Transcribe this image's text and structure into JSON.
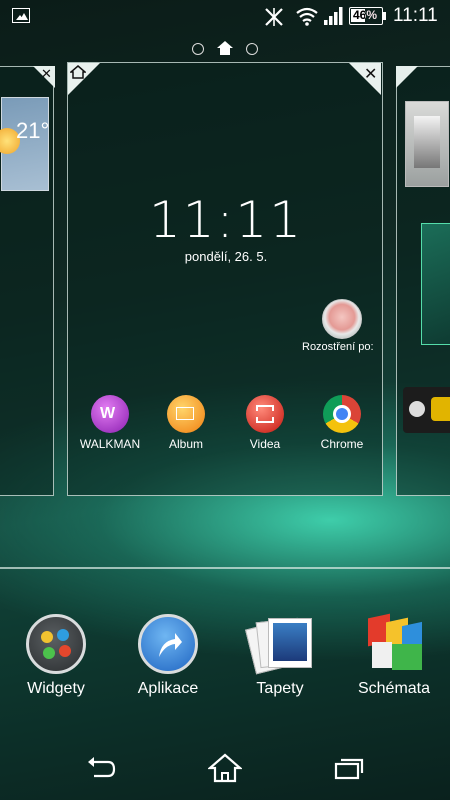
{
  "status_bar": {
    "battery": "46%",
    "time": "11:11"
  },
  "center_panel": {
    "clock": "11:11",
    "date": "pondělí, 26. 5.",
    "widget_label": "Rozostření po:",
    "apps": [
      {
        "label": "WALKMAN"
      },
      {
        "label": "Album"
      },
      {
        "label": "Videa"
      },
      {
        "label": "Chrome"
      }
    ]
  },
  "left_panel": {
    "weather_temp": "21°"
  },
  "dock": [
    {
      "label": "Widgety"
    },
    {
      "label": "Aplikace"
    },
    {
      "label": "Tapety"
    },
    {
      "label": "Schémata"
    }
  ],
  "colors": {
    "accent": "#3fe0b5",
    "background": "#0f2a24"
  }
}
